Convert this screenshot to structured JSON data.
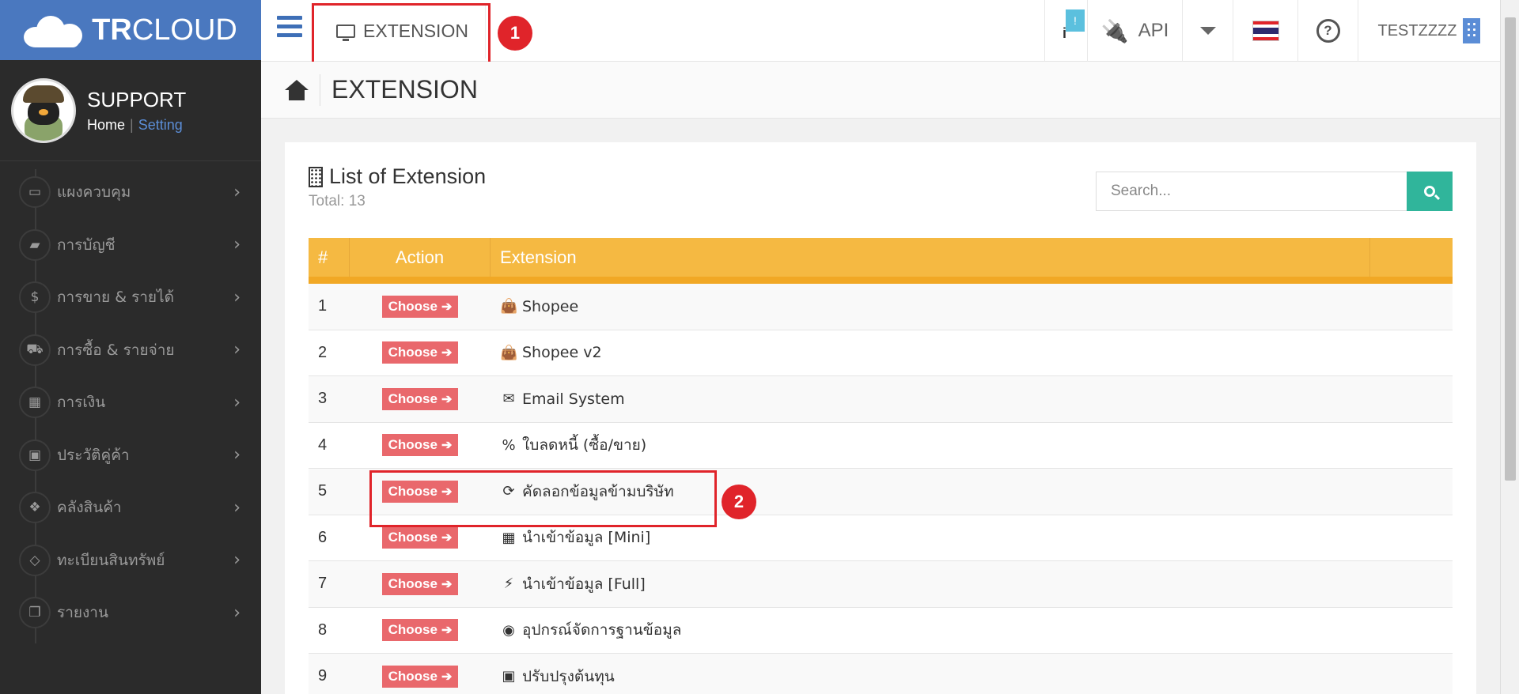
{
  "logo": {
    "text_bold": "TR",
    "text_light": "CLOUD"
  },
  "profile": {
    "name": "SUPPORT",
    "home_link": "Home",
    "separator": "|",
    "setting_link": "Setting"
  },
  "sidebar": {
    "items": [
      {
        "label": "แผงควบคุม",
        "icon": "monitor-icon",
        "glyph": "▭"
      },
      {
        "label": "การบัญชี",
        "icon": "book-icon",
        "glyph": "▰"
      },
      {
        "label": "การขาย & รายได้",
        "icon": "dollar-icon",
        "glyph": "$"
      },
      {
        "label": "การซื้อ & รายจ่าย",
        "icon": "cart-icon",
        "glyph": "⛟"
      },
      {
        "label": "การเงิน",
        "icon": "calendar-icon",
        "glyph": "▦"
      },
      {
        "label": "ประวัติคู่ค้า",
        "icon": "contact-book-icon",
        "glyph": "▣"
      },
      {
        "label": "คลังสินค้า",
        "icon": "cubes-icon",
        "glyph": "❖"
      },
      {
        "label": "ทะเบียนสินทรัพย์",
        "icon": "diamond-icon",
        "glyph": "◇"
      },
      {
        "label": "รายงาน",
        "icon": "clone-icon",
        "glyph": "❐"
      }
    ],
    "arrow": "›"
  },
  "topbar": {
    "tab_label": "EXTENSION",
    "info_badge": "!",
    "info_icon": "i",
    "api_label": "API",
    "user_label": "TESTZZZZ"
  },
  "annotations": {
    "first": "1",
    "second": "2"
  },
  "page": {
    "title": "EXTENSION"
  },
  "card": {
    "title": "List of Extension",
    "total": "Total: 13",
    "search_placeholder": "Search..."
  },
  "table": {
    "headers": {
      "num": "#",
      "action": "Action",
      "extension": "Extension"
    },
    "button_label": "Choose",
    "rows": [
      {
        "num": "1",
        "icon": "shopping-bag-icon",
        "glyph": "👜",
        "name": "Shopee"
      },
      {
        "num": "2",
        "icon": "shopping-bag-icon",
        "glyph": "👜",
        "name": "Shopee v2"
      },
      {
        "num": "3",
        "icon": "envelope-icon",
        "glyph": "✉",
        "name": "Email System"
      },
      {
        "num": "4",
        "icon": "percent-icon",
        "glyph": "%",
        "name": "ใบลดหนี้ (ซื้อ/ขาย)"
      },
      {
        "num": "5",
        "icon": "refresh-icon",
        "glyph": "⟳",
        "name": "คัดลอกข้อมูลข้ามบริษัท"
      },
      {
        "num": "6",
        "icon": "table-icon",
        "glyph": "▦",
        "name": "นำเข้าข้อมูล [Mini]"
      },
      {
        "num": "7",
        "icon": "magic-wand-icon",
        "glyph": "⚡",
        "name": "นำเข้าข้อมูล [Full]"
      },
      {
        "num": "8",
        "icon": "gamepad-icon",
        "glyph": "◉",
        "name": "อุปกรณ์จัดการฐานข้อมูล"
      },
      {
        "num": "9",
        "icon": "bus-icon",
        "glyph": "▣",
        "name": "ปรับปรุงต้นทุน"
      }
    ]
  }
}
